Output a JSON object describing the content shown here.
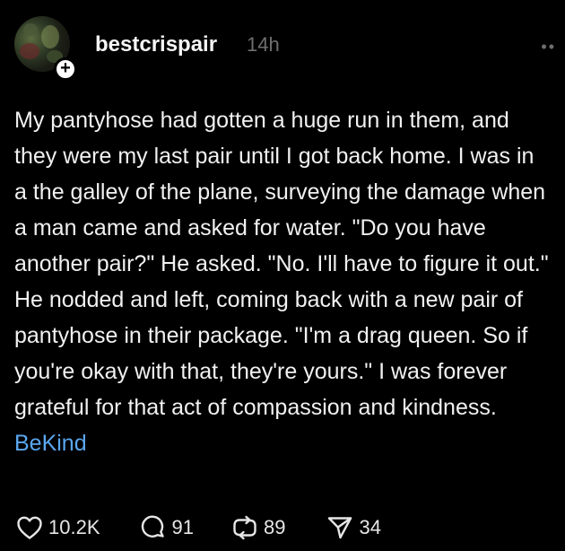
{
  "post": {
    "author": "bestcrispair",
    "time": "14h",
    "body": "My pantyhose had gotten a huge run in them, and they were my last pair until I got back home. I was in a the galley of the plane, surveying the damage when a man came and asked for water. \"Do you have another pair?\" He asked. \"No. I'll have to figure it out.\" He nodded and left, coming back with a new pair of pantyhose in their package. \"I'm a drag queen. So if you're okay with that, they're yours.\" I was forever grateful for that act of compassion and kindness.",
    "hashtag": "BeKind"
  },
  "actions": {
    "likes": "10.2K",
    "replies": "91",
    "reposts": "89",
    "shares": "34"
  },
  "icons": {
    "follow": "plus-icon",
    "more": "more-icon",
    "like": "heart-icon",
    "reply": "comment-icon",
    "repost": "repost-icon",
    "share": "send-icon"
  },
  "colors": {
    "background": "#000000",
    "text": "#f1f1f1",
    "muted": "#6f6f6f",
    "hashtag": "#5aa7f0"
  }
}
